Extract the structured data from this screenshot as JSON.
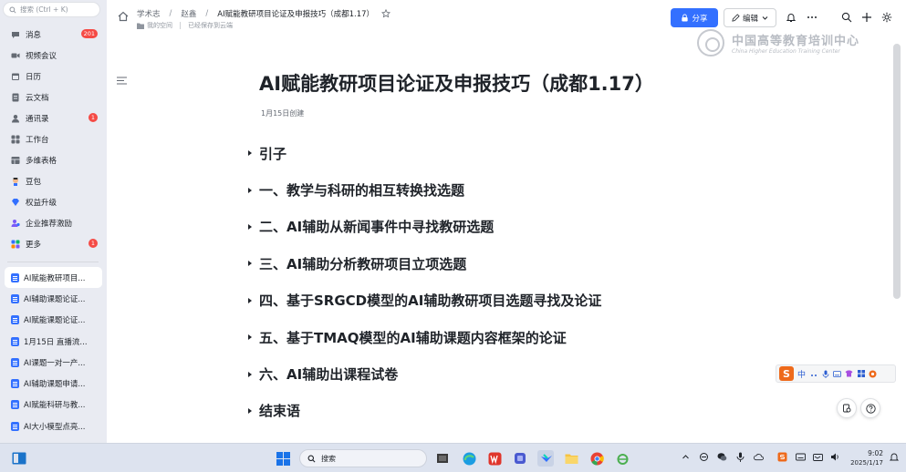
{
  "sidebar": {
    "search_placeholder": "搜索 (Ctrl + K)",
    "nav": [
      {
        "label": "消息",
        "badge": "201"
      },
      {
        "label": "视频会议"
      },
      {
        "label": "日历"
      },
      {
        "label": "云文档"
      },
      {
        "label": "通讯录",
        "badge": "1"
      },
      {
        "label": "工作台"
      },
      {
        "label": "多维表格"
      },
      {
        "label": "豆包"
      },
      {
        "label": "权益升级"
      },
      {
        "label": "企业推荐激励"
      },
      {
        "label": "更多",
        "badge": "1"
      }
    ],
    "docs": [
      "AI赋能教研项目...",
      "AI辅助课题论证...",
      "AI赋能课题论证...",
      "1月15日 直播流...",
      "AI课题一对一产...",
      "AI辅助课题申请...",
      "AI赋能科研与教...",
      "AI大小模型点亮..."
    ]
  },
  "topbar": {
    "breadcrumb": [
      "学术志",
      "赵鑫",
      "AI赋能教研项目论证及申报技巧（成都1.17）"
    ],
    "space": "我的空间",
    "saved": "已经保存到云端",
    "share": "分享",
    "edit": "编辑"
  },
  "watermark": {
    "cn": "中国高等教育培训中心",
    "en": "China Higher Education Training Center"
  },
  "document": {
    "title": "AI赋能教研项目论证及申报技巧（成都1.17）",
    "created": "1月15日创建",
    "headings": [
      "引子",
      "一、教学与科研的相互转换找选题",
      "二、AI辅助从新闻事件中寻找教研选题",
      "三、AI辅助分析教研项目立项选题",
      "四、基于SRGCD模型的AI辅助教研项目选题寻找及论证",
      "五、基于TMAQ模型的AI辅助课题内容框架的论证",
      "六、AI辅助出课程试卷",
      "结束语"
    ]
  },
  "ime": {
    "logo": "S",
    "mode": "中"
  },
  "taskbar": {
    "search": "搜索",
    "time": "9:02",
    "date": "2025/1/17"
  },
  "colors": {
    "accent": "#3370ff",
    "badge": "#f54a45"
  }
}
